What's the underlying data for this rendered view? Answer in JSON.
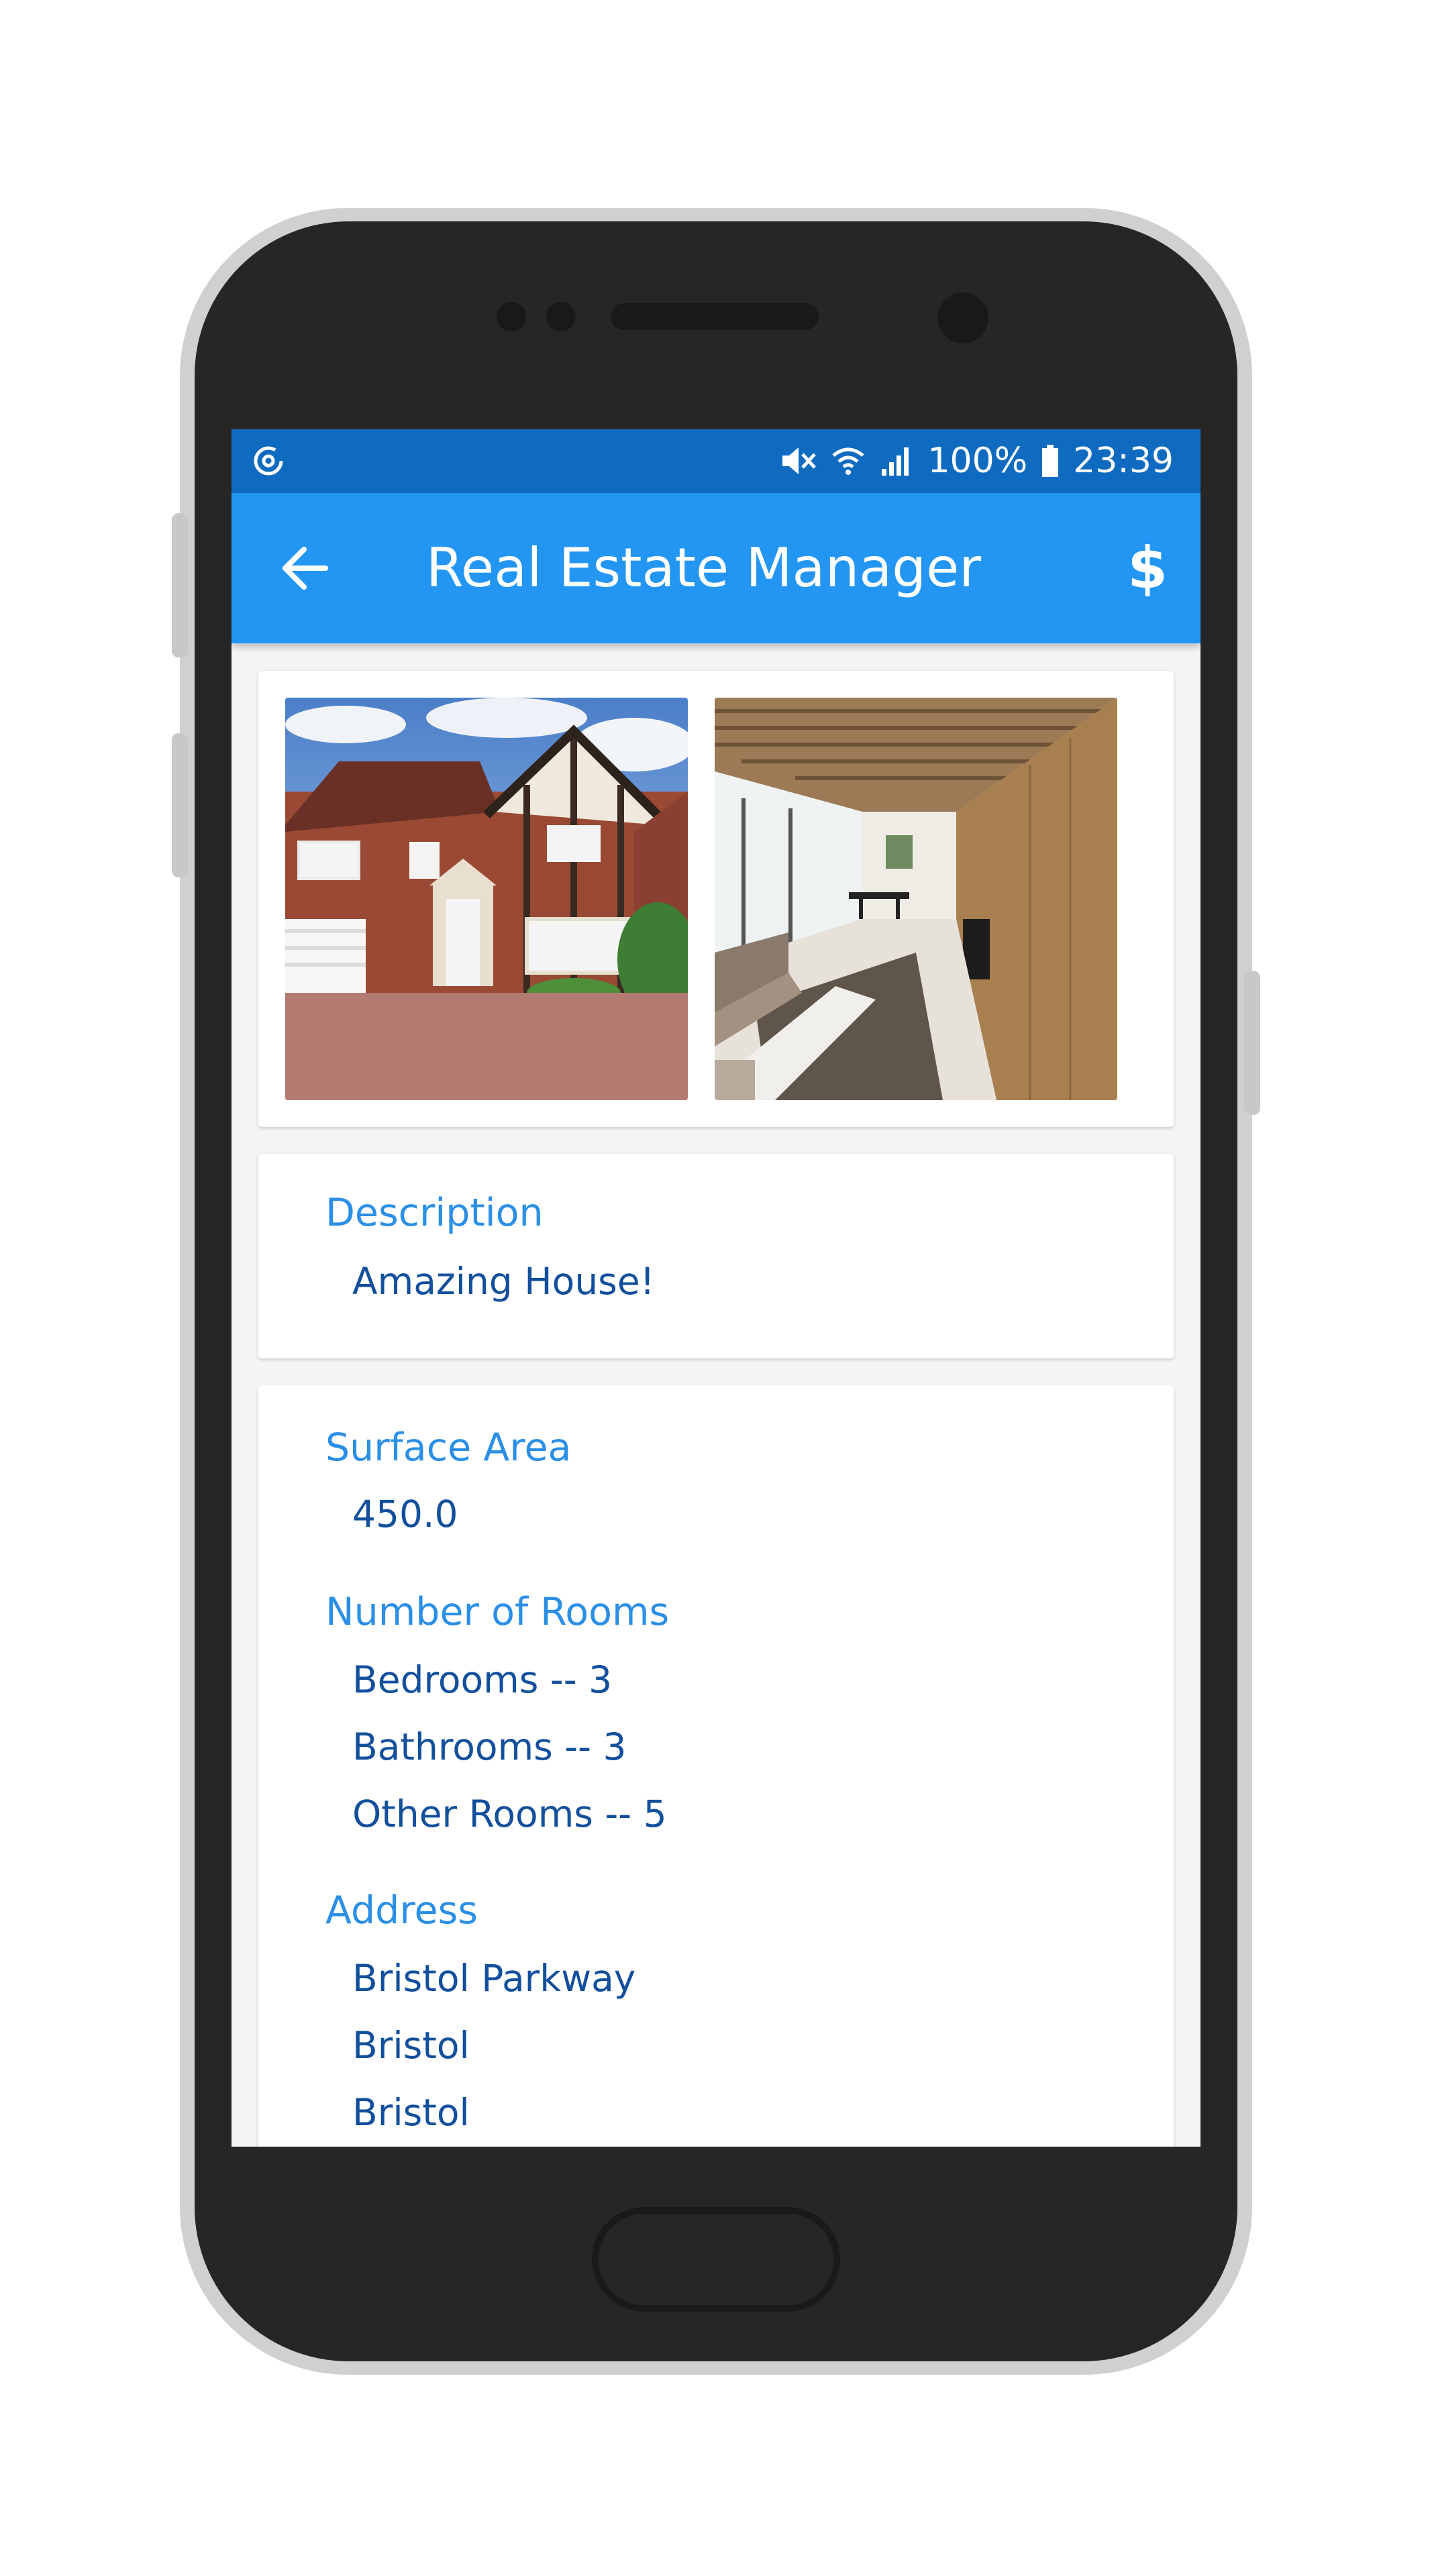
{
  "status_bar": {
    "battery": "100%",
    "time": "23:39",
    "icons": [
      "data-saver-icon",
      "mute-icon",
      "wifi-icon",
      "signal-icon",
      "battery-icon"
    ]
  },
  "app_bar": {
    "title": "Real Estate Manager",
    "back_icon": "arrow-left-icon",
    "price_icon": "$"
  },
  "photos": [
    {
      "name": "house-exterior-photo"
    },
    {
      "name": "living-room-photo"
    }
  ],
  "description": {
    "label": "Description",
    "value": "Amazing House!"
  },
  "details": {
    "surface_area_label": "Surface Area",
    "surface_area_value": "450.0",
    "rooms_label": "Number of Rooms",
    "bedrooms": "Bedrooms -- 3",
    "bathrooms": "Bathrooms -- 3",
    "other_rooms": "Other Rooms -- 5",
    "address_label": "Address",
    "address_lines": [
      "Bristol Parkway",
      "Bristol",
      "Bristol"
    ]
  },
  "colors": {
    "status_bar": "#0f6bbf",
    "app_bar": "#2396f3",
    "label": "#2b8fe6",
    "value": "#124f9c"
  }
}
